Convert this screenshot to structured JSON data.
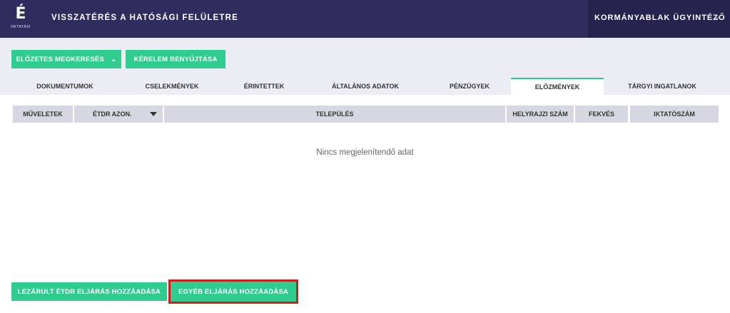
{
  "header": {
    "logo_letter": "É",
    "logo_sub": "OKTATÁSI",
    "title": "VISSZATÉRÉS A HATÓSÁGI FELÜLETRE",
    "user": "KORMÁNYABLAK ÜGYINTÉZŐ",
    "user_chevron_icon": "chevron-down-icon"
  },
  "actions": {
    "prior_search": "ELŐZETES MEGKERESÉS",
    "submit_request": "KÉRELEM BENYÚJTÁSA"
  },
  "tabs": [
    {
      "label": "DOKUMENTUMOK",
      "active": false
    },
    {
      "label": "CSELEKMÉNYEK",
      "active": false
    },
    {
      "label": "ÉRINTETTEK",
      "active": false
    },
    {
      "label": "ÁLTALÁNOS ADATOK",
      "active": false
    },
    {
      "label": "PÉNZÜGYEK",
      "active": false
    },
    {
      "label": "ELŐZMÉNYEK",
      "active": true
    },
    {
      "label": "TÁRGYI INGATLANOK",
      "active": false
    }
  ],
  "table": {
    "columns": [
      "MŰVELETEK",
      "ÉTDR AZON.",
      "TELEPÜLÉS",
      "HELYRAJZI SZÁM",
      "FEKVÉS",
      "IKTATÓSZÁM"
    ],
    "empty_message": "Nincs megjelenítendő adat"
  },
  "footer": {
    "add_closed": "LEZÁRULT ÉTDR ELJÁRÁS HOZZÁADÁSA",
    "add_other": "EGYÉB ELJÁRÁS HOZZÁADÁSA"
  },
  "colors": {
    "header_bg": "#2f2d5e",
    "accent": "#2ecc8f",
    "highlight": "#d01e1e"
  }
}
